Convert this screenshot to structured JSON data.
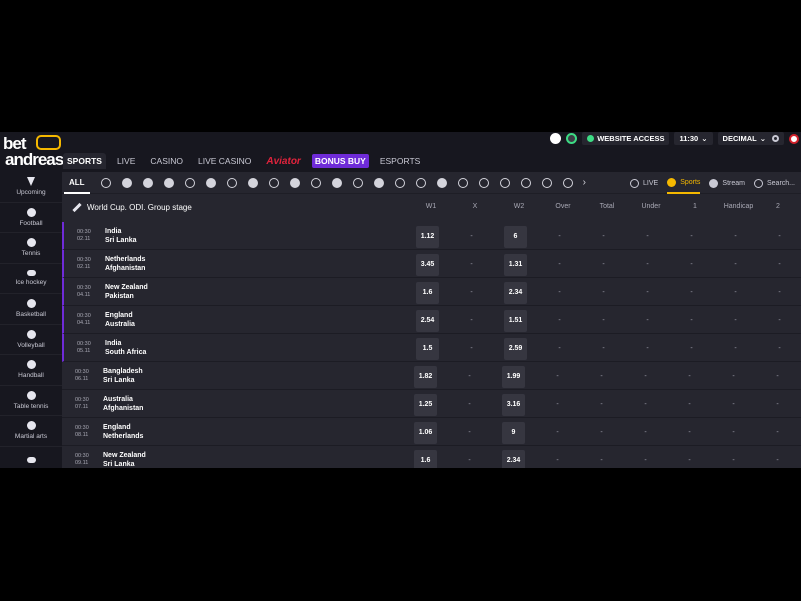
{
  "brand": {
    "line1": "bet",
    "line2": "andreas",
    "accent": "#f5b800"
  },
  "topbar": {
    "website_access": "WEBSITE ACCESS",
    "time": "11:30",
    "time_chevron": "⌄",
    "odds_format": "DECIMAL",
    "odds_chevron": "⌄"
  },
  "nav": {
    "sports": "SPORTS",
    "live": "LIVE",
    "casino": "CASINO",
    "live_casino": "LIVE CASINO",
    "aviator": "Aviator",
    "bonus_buy": "BONUS BUY",
    "esports": "ESPORTS"
  },
  "sidebar": {
    "items": [
      {
        "label": "Upcoming",
        "icon": "lightning-icon"
      },
      {
        "label": "Football",
        "icon": "football-icon"
      },
      {
        "label": "Tennis",
        "icon": "tennis-icon"
      },
      {
        "label": "Ice hockey",
        "icon": "ice-hockey-icon"
      },
      {
        "label": "Basketball",
        "icon": "basketball-icon"
      },
      {
        "label": "Volleyball",
        "icon": "volleyball-icon"
      },
      {
        "label": "Handball",
        "icon": "handball-icon"
      },
      {
        "label": "Table tennis",
        "icon": "table-tennis-icon"
      },
      {
        "label": "Martial arts",
        "icon": "martial-arts-icon"
      },
      {
        "label": "",
        "icon": "more-sport-icon"
      }
    ]
  },
  "sportsbar": {
    "all": "ALL",
    "more": "›",
    "live": "LIVE",
    "sports": "Sports",
    "stream": "Stream",
    "search": "Search..."
  },
  "market": {
    "league": "World Cup. ODI. Group stage",
    "columns": [
      "W1",
      "X",
      "W2",
      "Over",
      "Total",
      "Under",
      "1",
      "Handicap",
      "2"
    ]
  },
  "matches": [
    {
      "time": "00:30",
      "date": "02.11",
      "home": "India",
      "away": "Sri Lanka",
      "w1": "1.12",
      "x": "-",
      "w2": "6",
      "over": "-",
      "total": "-",
      "under": "-",
      "h1": "-",
      "handicap": "-",
      "h2": "-"
    },
    {
      "time": "00:30",
      "date": "02.11",
      "home": "Netherlands",
      "away": "Afghanistan",
      "w1": "3.45",
      "x": "-",
      "w2": "1.31",
      "over": "-",
      "total": "-",
      "under": "-",
      "h1": "-",
      "handicap": "-",
      "h2": "-"
    },
    {
      "time": "00:30",
      "date": "04.11",
      "home": "New Zealand",
      "away": "Pakistan",
      "w1": "1.6",
      "x": "-",
      "w2": "2.34",
      "over": "-",
      "total": "-",
      "under": "-",
      "h1": "-",
      "handicap": "-",
      "h2": "-"
    },
    {
      "time": "00:30",
      "date": "04.11",
      "home": "England",
      "away": "Australia",
      "w1": "2.54",
      "x": "-",
      "w2": "1.51",
      "over": "-",
      "total": "-",
      "under": "-",
      "h1": "-",
      "handicap": "-",
      "h2": "-"
    },
    {
      "time": "00:30",
      "date": "05.11",
      "home": "India",
      "away": "South Africa",
      "w1": "1.5",
      "x": "-",
      "w2": "2.59",
      "over": "-",
      "total": "-",
      "under": "-",
      "h1": "-",
      "handicap": "-",
      "h2": "-"
    },
    {
      "time": "00:30",
      "date": "06.11",
      "home": "Bangladesh",
      "away": "Sri Lanka",
      "w1": "1.82",
      "x": "-",
      "w2": "1.99",
      "over": "-",
      "total": "-",
      "under": "-",
      "h1": "-",
      "handicap": "-",
      "h2": "-"
    },
    {
      "time": "00:30",
      "date": "07.11",
      "home": "Australia",
      "away": "Afghanistan",
      "w1": "1.25",
      "x": "-",
      "w2": "3.16",
      "over": "-",
      "total": "-",
      "under": "-",
      "h1": "-",
      "handicap": "-",
      "h2": "-"
    },
    {
      "time": "00:30",
      "date": "08.11",
      "home": "England",
      "away": "Netherlands",
      "w1": "1.06",
      "x": "-",
      "w2": "9",
      "over": "-",
      "total": "-",
      "under": "-",
      "h1": "-",
      "handicap": "-",
      "h2": "-"
    },
    {
      "time": "00:30",
      "date": "09.11",
      "home": "New Zealand",
      "away": "Sri Lanka",
      "w1": "1.6",
      "x": "-",
      "w2": "2.34",
      "over": "-",
      "total": "-",
      "under": "-",
      "h1": "-",
      "handicap": "-",
      "h2": "-"
    }
  ]
}
